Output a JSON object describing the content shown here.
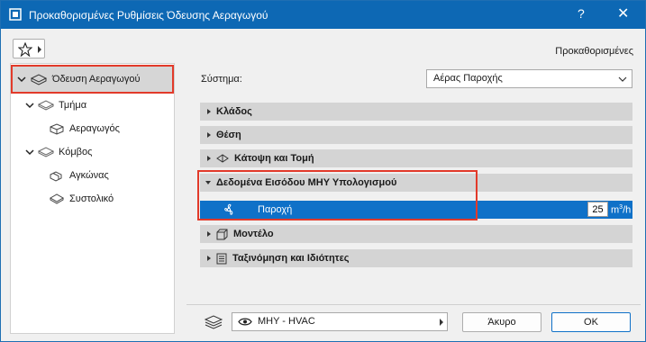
{
  "window": {
    "title": "Προκαθορισμένες Ρυθμίσεις Όδευσης Αεραγωγού",
    "help": "?",
    "close": "✕"
  },
  "toolbar": {
    "defaults_label": "Προκαθορισμένες"
  },
  "tree": {
    "root": "Όδευση Αεραγωγού",
    "items": [
      {
        "label": "Τμήμα"
      },
      {
        "label": "Αεραγωγός"
      },
      {
        "label": "Κόμβος"
      },
      {
        "label": "Αγκώνας"
      },
      {
        "label": "Συστολικό"
      }
    ]
  },
  "system": {
    "label": "Σύστημα:",
    "value": "Αέρας Παροχής"
  },
  "sections": [
    {
      "label": "Κλάδος"
    },
    {
      "label": "Θέση"
    },
    {
      "label": "Κάτοψη και Τομή"
    },
    {
      "label": "Δεδομένα Εισόδου ΜΗΥ Υπολογισμού"
    },
    {
      "label": "Μοντέλο"
    },
    {
      "label": "Ταξινόμηση και Ιδιότητες"
    }
  ],
  "parameter": {
    "label": "Παροχή",
    "value": "25",
    "unit_base": "m",
    "unit_sup": "3",
    "unit_rest": "/h"
  },
  "footer": {
    "layer": "ΜΗΥ - HVAC",
    "cancel": "Άκυρο",
    "ok": "OK"
  },
  "colors": {
    "titlebar": "#0d68b4",
    "selection": "#0f71c8",
    "highlight": "#e23a2a"
  }
}
